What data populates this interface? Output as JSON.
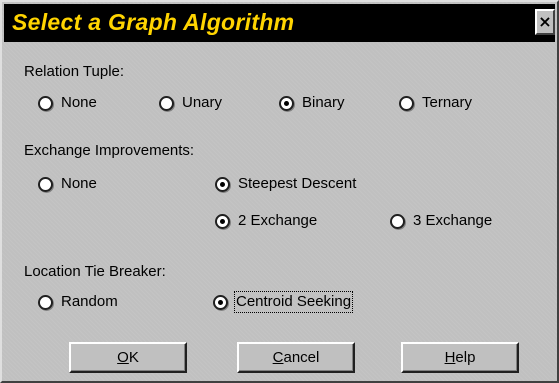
{
  "window": {
    "title": "Select a Graph Algorithm",
    "close_glyph": "×"
  },
  "relation_tuple": {
    "label": "Relation Tuple:",
    "options": [
      {
        "label": "None",
        "selected": false
      },
      {
        "label": "Unary",
        "selected": false
      },
      {
        "label": "Binary",
        "selected": true
      },
      {
        "label": "Ternary",
        "selected": false
      }
    ]
  },
  "exchange_improvements": {
    "label": "Exchange Improvements:",
    "options": [
      {
        "label": "None",
        "selected": false
      },
      {
        "label": "Steepest Descent",
        "selected": true
      },
      {
        "label": "2 Exchange",
        "selected": true
      },
      {
        "label": "3 Exchange",
        "selected": false
      }
    ]
  },
  "location_tie_breaker": {
    "label": "Location Tie Breaker:",
    "options": [
      {
        "label": "Random",
        "selected": false
      },
      {
        "label": "Centroid Seeking",
        "selected": true
      }
    ]
  },
  "buttons": {
    "ok": {
      "mnemonic": "O",
      "rest": "K"
    },
    "cancel": {
      "mnemonic": "C",
      "rest": "ancel"
    },
    "help": {
      "mnemonic": "H",
      "rest": "elp"
    }
  },
  "colors": {
    "title_text": "#ffd400",
    "title_bar": "#000000",
    "dialog_face": "#c0c0c0"
  },
  "icons": {
    "close": "close-icon",
    "radio": "radio-button"
  }
}
